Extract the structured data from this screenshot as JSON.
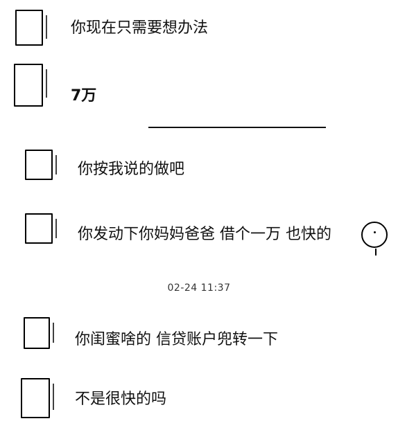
{
  "chat": {
    "messages": [
      {
        "text": "你现在只需要想办法"
      },
      {
        "text": "7万"
      },
      {
        "text": "你按我说的做吧"
      },
      {
        "text": "你发动下你妈妈爸爸 借个一万 也快的"
      },
      {
        "text": "你闺蜜啥的 信贷账户兜转一下"
      },
      {
        "text": "不是很快的吗"
      }
    ],
    "timestamp": "02-24 11:37"
  }
}
